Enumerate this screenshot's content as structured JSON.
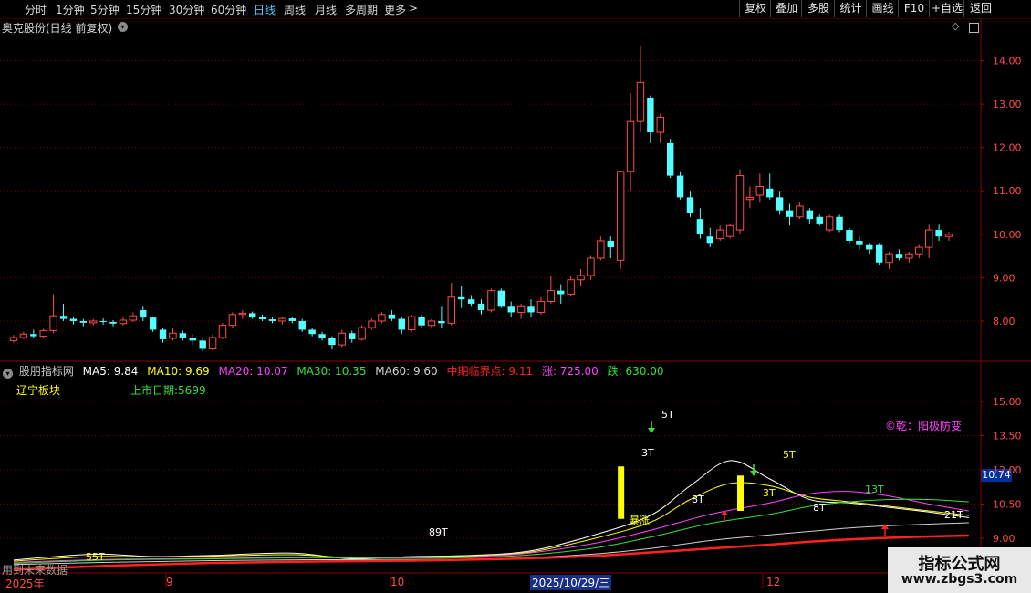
{
  "toolbar": {
    "periods": [
      "分时",
      "1分钟",
      "5分钟",
      "15分钟",
      "30分钟",
      "60分钟",
      "日线",
      "周线",
      "月线",
      "多周期",
      "更多"
    ],
    "active_period": "日线",
    "right_buttons": [
      "复权",
      "叠加",
      "多股",
      "统计",
      "画线",
      "F10",
      "+自选",
      "返回"
    ]
  },
  "main_chart": {
    "title": "奥克股份(日线 前复权)"
  },
  "indicator": {
    "name": "股朋指标网",
    "ma5": "MA5: 9.84",
    "ma10": "MA10: 9.69",
    "ma20": "MA20: 10.07",
    "ma30": "MA30: 10.35",
    "ma60": "MA60: 9.60",
    "critical": "中期临界点: 9.11",
    "up": "涨: 725.00",
    "down": "跌: 630.00",
    "sector": "辽宁板块",
    "listing": "上市日期:5699",
    "signal_text": "©乾：阳极防变",
    "current_value": "10.74",
    "labels": {
      "t5a": "5T",
      "t3a": "3T",
      "t5b": "5T",
      "t3b": "3T",
      "t8a": "8T",
      "t8b": "8T",
      "t13": "13T",
      "t21": "21T",
      "t89": "89T",
      "t55": "55T",
      "surge": "暴涨"
    }
  },
  "colors": {
    "up": "#ff4a4a",
    "down": "#54ffff",
    "ma5": "#ffffff",
    "ma10": "#ffff00",
    "ma20": "#ff40ff",
    "ma30": "#38e038",
    "ma60": "#d0d0d0",
    "critical": "#ff2020",
    "grid": "#6b0000",
    "bg": "#000000"
  },
  "time_axis": {
    "labels": [
      "2025年",
      "9",
      "10",
      "2025/10/29/三",
      "12"
    ],
    "status": "用到未来数据"
  },
  "watermark": {
    "line1": "指标公式网",
    "line2": "www.zbgs3.com"
  },
  "chart_data": [
    {
      "type": "candlestick",
      "title": "奥克股份(日线 前复权)",
      "ylim": [
        7.2,
        14.6
      ],
      "yticks": [
        8.0,
        9.0,
        10.0,
        11.0,
        12.0,
        13.0,
        14.0
      ],
      "ohlc": [
        [
          7.55,
          7.68,
          7.5,
          7.62
        ],
        [
          7.62,
          7.75,
          7.58,
          7.7
        ],
        [
          7.7,
          7.8,
          7.6,
          7.65
        ],
        [
          7.65,
          7.82,
          7.62,
          7.78
        ],
        [
          7.78,
          8.62,
          7.72,
          8.12
        ],
        [
          8.12,
          8.4,
          8.0,
          8.05
        ],
        [
          8.05,
          8.1,
          7.92,
          8.0
        ],
        [
          8.0,
          8.05,
          7.88,
          7.96
        ],
        [
          7.96,
          8.05,
          7.9,
          8.0
        ],
        [
          8.0,
          8.06,
          7.92,
          7.98
        ],
        [
          7.98,
          8.02,
          7.88,
          7.94
        ],
        [
          7.94,
          8.08,
          7.9,
          8.02
        ],
        [
          8.02,
          8.2,
          7.98,
          8.12
        ],
        [
          8.25,
          8.35,
          8.0,
          8.08
        ],
        [
          8.08,
          8.1,
          7.75,
          7.8
        ],
        [
          7.8,
          7.85,
          7.5,
          7.58
        ],
        [
          7.6,
          7.85,
          7.55,
          7.72
        ],
        [
          7.72,
          7.78,
          7.55,
          7.62
        ],
        [
          7.62,
          7.7,
          7.45,
          7.55
        ],
        [
          7.55,
          7.62,
          7.3,
          7.38
        ],
        [
          7.38,
          7.7,
          7.32,
          7.62
        ],
        [
          7.62,
          7.95,
          7.58,
          7.9
        ],
        [
          7.9,
          8.2,
          7.85,
          8.15
        ],
        [
          8.15,
          8.25,
          8.05,
          8.18
        ],
        [
          8.18,
          8.22,
          8.05,
          8.1
        ],
        [
          8.1,
          8.15,
          8.0,
          8.04
        ],
        [
          8.04,
          8.08,
          7.95,
          8.0
        ],
        [
          8.0,
          8.1,
          7.92,
          8.06
        ],
        [
          8.06,
          8.1,
          7.95,
          8.0
        ],
        [
          8.0,
          8.05,
          7.75,
          7.8
        ],
        [
          7.8,
          7.85,
          7.65,
          7.7
        ],
        [
          7.7,
          7.75,
          7.55,
          7.6
        ],
        [
          7.6,
          7.65,
          7.35,
          7.45
        ],
        [
          7.45,
          7.8,
          7.4,
          7.72
        ],
        [
          7.72,
          7.78,
          7.5,
          7.58
        ],
        [
          7.58,
          7.9,
          7.55,
          7.85
        ],
        [
          7.85,
          8.05,
          7.8,
          8.0
        ],
        [
          8.0,
          8.2,
          7.95,
          8.15
        ],
        [
          8.15,
          8.25,
          8.0,
          8.05
        ],
        [
          8.05,
          8.1,
          7.7,
          7.8
        ],
        [
          7.8,
          8.15,
          7.75,
          8.1
        ],
        [
          8.1,
          8.15,
          7.85,
          7.9
        ],
        [
          7.9,
          8.05,
          7.85,
          8.0
        ],
        [
          8.0,
          8.35,
          7.85,
          7.95
        ],
        [
          7.95,
          8.88,
          7.9,
          8.55
        ],
        [
          8.55,
          8.8,
          8.3,
          8.5
        ],
        [
          8.5,
          8.6,
          8.35,
          8.4
        ],
        [
          8.4,
          8.5,
          8.15,
          8.25
        ],
        [
          8.25,
          8.75,
          8.2,
          8.7
        ],
        [
          8.7,
          8.75,
          8.3,
          8.35
        ],
        [
          8.35,
          8.45,
          8.1,
          8.2
        ],
        [
          8.2,
          8.4,
          8.05,
          8.35
        ],
        [
          8.35,
          8.5,
          8.1,
          8.2
        ],
        [
          8.2,
          8.55,
          8.15,
          8.45
        ],
        [
          8.45,
          9.05,
          8.4,
          8.7
        ],
        [
          8.7,
          8.85,
          8.4,
          8.62
        ],
        [
          8.62,
          9.05,
          8.58,
          8.95
        ],
        [
          8.95,
          9.2,
          8.8,
          9.05
        ],
        [
          9.05,
          9.5,
          8.95,
          9.45
        ],
        [
          9.45,
          9.95,
          9.4,
          9.85
        ],
        [
          9.85,
          9.95,
          9.45,
          9.7
        ],
        [
          9.4,
          11.4,
          9.2,
          11.45
        ],
        [
          11.45,
          13.25,
          11.0,
          12.6
        ],
        [
          12.6,
          14.35,
          12.35,
          13.5
        ],
        [
          13.15,
          13.2,
          12.1,
          12.35
        ],
        [
          12.35,
          12.78,
          12.1,
          12.7
        ],
        [
          12.1,
          12.2,
          11.3,
          11.35
        ],
        [
          11.35,
          11.45,
          10.8,
          10.85
        ],
        [
          10.85,
          11.0,
          10.4,
          10.5
        ],
        [
          10.35,
          10.6,
          9.9,
          10.0
        ],
        [
          9.95,
          10.15,
          9.7,
          9.8
        ],
        [
          9.9,
          10.2,
          9.85,
          10.1
        ],
        [
          9.95,
          10.25,
          9.9,
          10.2
        ],
        [
          10.1,
          11.5,
          10.0,
          11.35
        ],
        [
          10.8,
          11.1,
          10.6,
          10.85
        ],
        [
          10.9,
          11.4,
          10.75,
          11.1
        ],
        [
          11.05,
          11.4,
          10.8,
          10.85
        ],
        [
          10.85,
          11.0,
          10.45,
          10.55
        ],
        [
          10.55,
          10.7,
          10.2,
          10.4
        ],
        [
          10.4,
          10.75,
          10.35,
          10.65
        ],
        [
          10.55,
          10.6,
          10.25,
          10.35
        ],
        [
          10.4,
          10.45,
          10.2,
          10.25
        ],
        [
          10.1,
          10.45,
          10.05,
          10.4
        ],
        [
          10.4,
          10.45,
          10.05,
          10.1
        ],
        [
          10.1,
          10.15,
          9.8,
          9.85
        ],
        [
          9.85,
          9.95,
          9.65,
          9.75
        ],
        [
          9.75,
          9.8,
          9.55,
          9.65
        ],
        [
          9.75,
          9.8,
          9.3,
          9.35
        ],
        [
          9.35,
          9.6,
          9.2,
          9.55
        ],
        [
          9.55,
          9.65,
          9.4,
          9.45
        ],
        [
          9.45,
          9.6,
          9.35,
          9.55
        ],
        [
          9.55,
          9.75,
          9.45,
          9.7
        ],
        [
          9.7,
          10.22,
          9.45,
          10.1
        ],
        [
          10.1,
          10.22,
          9.85,
          9.95
        ],
        [
          9.95,
          10.05,
          9.85,
          10.0
        ]
      ]
    },
    {
      "type": "line",
      "ylim": [
        7.6,
        16.0
      ],
      "yticks": [
        9.0,
        10.5,
        12.0,
        13.5,
        15.0
      ],
      "series": [
        {
          "name": "MA5",
          "color": "#ffffff",
          "x": [
            0,
            8,
            14,
            20,
            28,
            34,
            40,
            46,
            52,
            58,
            64,
            68,
            72,
            76,
            80,
            84,
            88,
            92,
            96
          ],
          "y": [
            8.05,
            8.3,
            8.2,
            8.25,
            8.35,
            8.1,
            8.2,
            8.25,
            8.45,
            9.1,
            10.0,
            11.3,
            12.4,
            11.6,
            10.7,
            10.55,
            10.35,
            10.15,
            9.9
          ]
        },
        {
          "name": "MA10",
          "color": "#ffff00",
          "x": [
            0,
            8,
            14,
            20,
            28,
            34,
            40,
            46,
            52,
            58,
            64,
            68,
            72,
            76,
            80,
            84,
            88,
            92,
            96
          ],
          "y": [
            8.0,
            8.2,
            8.18,
            8.22,
            8.28,
            8.15,
            8.18,
            8.22,
            8.4,
            8.95,
            9.7,
            10.7,
            11.4,
            11.3,
            10.8,
            10.6,
            10.4,
            10.2,
            10.0
          ]
        },
        {
          "name": "MA20",
          "color": "#ff40ff",
          "x": [
            0,
            10,
            20,
            30,
            40,
            50,
            58,
            64,
            70,
            76,
            80,
            84,
            88,
            92,
            96
          ],
          "y": [
            7.95,
            8.08,
            8.12,
            8.18,
            8.15,
            8.28,
            8.75,
            9.35,
            10.05,
            10.55,
            10.95,
            11.05,
            10.85,
            10.5,
            10.2
          ]
        },
        {
          "name": "MA30",
          "color": "#38e038",
          "x": [
            0,
            10,
            20,
            30,
            40,
            50,
            58,
            64,
            70,
            76,
            80,
            84,
            88,
            92,
            96
          ],
          "y": [
            7.9,
            8.05,
            8.1,
            8.15,
            8.12,
            8.22,
            8.55,
            9.05,
            9.65,
            10.05,
            10.4,
            10.6,
            10.7,
            10.7,
            10.6
          ]
        },
        {
          "name": "MA60",
          "color": "#d0d0d0",
          "x": [
            0,
            10,
            20,
            30,
            40,
            50,
            58,
            64,
            70,
            76,
            80,
            84,
            88,
            92,
            96
          ],
          "y": [
            7.85,
            7.95,
            8.02,
            8.06,
            8.06,
            8.12,
            8.3,
            8.55,
            8.9,
            9.15,
            9.3,
            9.45,
            9.55,
            9.62,
            9.68
          ]
        },
        {
          "name": "中期临界点",
          "color": "#ff2020",
          "x": [
            0,
            10,
            20,
            30,
            40,
            50,
            58,
            64,
            70,
            76,
            80,
            84,
            88,
            92,
            96
          ],
          "y": [
            7.62,
            7.8,
            7.92,
            7.98,
            8.02,
            8.1,
            8.22,
            8.38,
            8.55,
            8.72,
            8.85,
            8.95,
            9.02,
            9.08,
            9.12
          ]
        }
      ]
    }
  ]
}
